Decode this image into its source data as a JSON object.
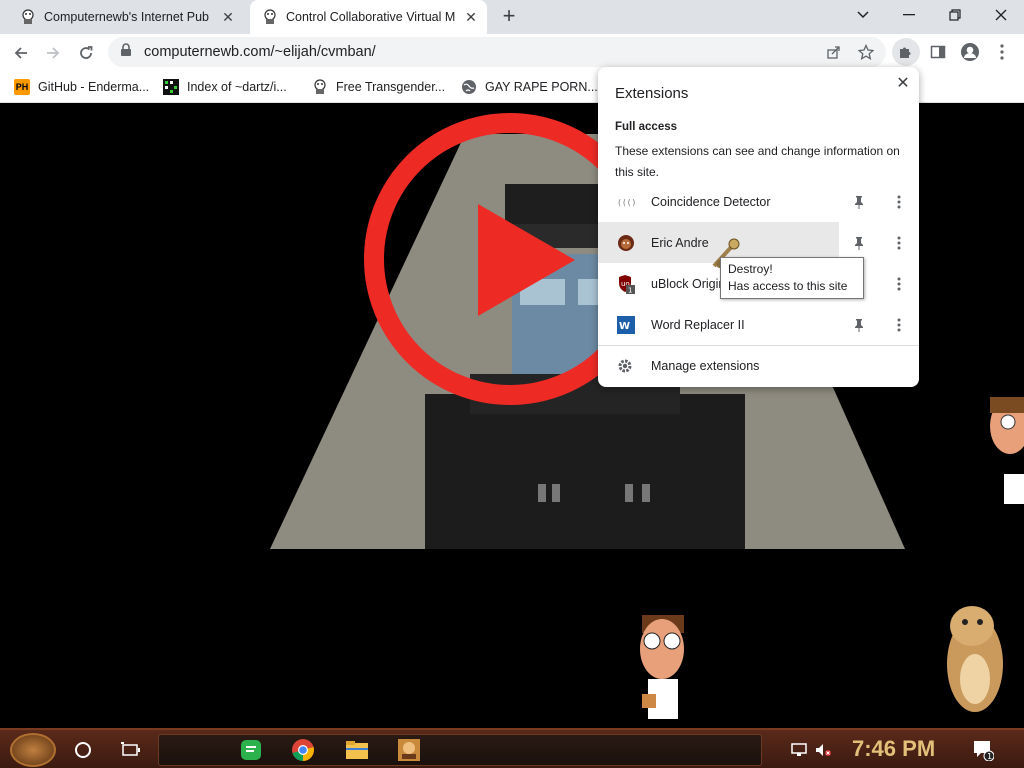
{
  "browser": {
    "tabs": [
      {
        "title": "Computernewb's Internet Pub",
        "active": false
      },
      {
        "title": "Control Collaborative Virtual M",
        "active": true
      }
    ],
    "url": "computernewb.com/~elijah/cvmban/",
    "bookmarks": [
      {
        "label": "GitHub - Enderma...",
        "icon": "PH"
      },
      {
        "label": "Index of ~dartz/i...",
        "icon": "grid-icon"
      },
      {
        "label": "Free Transgender...",
        "icon": "mascot-icon"
      },
      {
        "label": "GAY RAPE PORN...",
        "icon": "globe-icon"
      }
    ]
  },
  "extensions": {
    "title": "Extensions",
    "section": "Full access",
    "description": "These extensions can see and change information on this site.",
    "items": [
      {
        "name": "Coincidence Detector"
      },
      {
        "name": "Eric Andre"
      },
      {
        "name": "uBlock Origin",
        "badge": "1"
      },
      {
        "name": "Word Replacer II"
      }
    ],
    "manage": "Manage extensions"
  },
  "tooltip": {
    "line1": "Destroy!",
    "line2": "Has access to this site"
  },
  "taskbar": {
    "clock": "7:46 PM",
    "notification_count": "1"
  },
  "colors": {
    "play_button": "#ee2a24",
    "taskbar": "#4a2214",
    "clock": "#e3c079"
  }
}
